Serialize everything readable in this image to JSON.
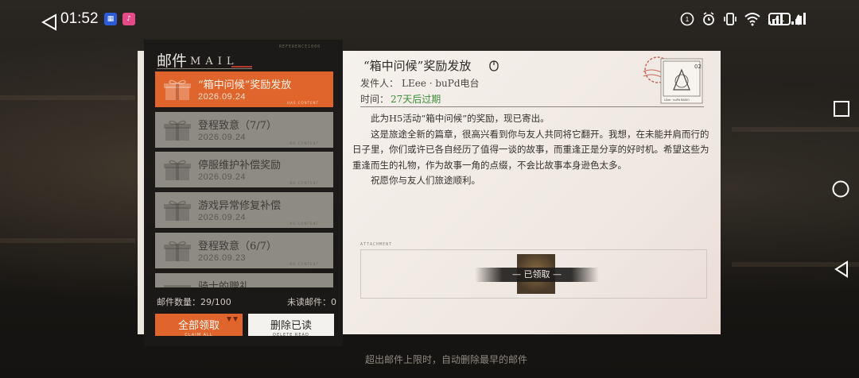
{
  "status_bar": {
    "time": "01:52",
    "battery": "41"
  },
  "mail_panel": {
    "title": "邮件",
    "title_en": "MAIL",
    "deco_text": "REFERENCE1000",
    "items": [
      {
        "title": "“箱中问候”奖励发放",
        "date": "2026.09.24",
        "deco": "HAS CONTENT",
        "selected": true
      },
      {
        "title": "登程致意（7/7）",
        "date": "2026.09.24",
        "deco": "NO CONTENT",
        "selected": false
      },
      {
        "title": "停服维护补偿奖励",
        "date": "2026.09.24",
        "deco": "NO CONTENT",
        "selected": false
      },
      {
        "title": "游戏异常修复补偿",
        "date": "2026.09.24",
        "deco": "NO CONTENT",
        "selected": false
      },
      {
        "title": "登程致意（6/7）",
        "date": "2026.09.23",
        "deco": "NO CONTENT",
        "selected": false
      },
      {
        "title": "骑士的赠礼",
        "date": "",
        "deco": "",
        "selected": false
      }
    ],
    "mail_count_label": "邮件数量：",
    "mail_count": "29/100",
    "unread_label": "未读邮件：",
    "unread_count": "0",
    "claim_all": "全部领取",
    "claim_all_sub": "CLAIM ALL",
    "delete_read": "删除已读",
    "delete_read_sub": "DELETE READ"
  },
  "mail_detail": {
    "title": "“箱中问候”奖励发放",
    "sender_label": "发件人：",
    "sender": "LEee · buPd电台",
    "time_label": "时间：",
    "expire": "27天后过期",
    "paragraphs": [
      "此为H5活动“箱中问候”的奖励，现已寄出。",
      "这是旅途全新的篇章，很高兴看到你与友人共同将它翻开。我想，在未能并肩而行的日子里，你们或许已各自经历了值得一谈的故事，而重逢正是分享的好时机。希望这些为重逢而生的礼物，作为故事一角的点缀，不会比故事本身逊色太多。",
      "祝愿你与友人们旅途顺利。"
    ],
    "attachment_label": "ATTACHMENT",
    "claimed_text": "— 已领取 —",
    "stamp_text": "LEee · buPd RADIO",
    "stamp_number": "02"
  },
  "footer_note": "超出邮件上限时，自动删除最早的邮件",
  "colors": {
    "accent": "#e0652c",
    "expire": "#3e8d3a",
    "panel_bg": "#1c1a18"
  }
}
